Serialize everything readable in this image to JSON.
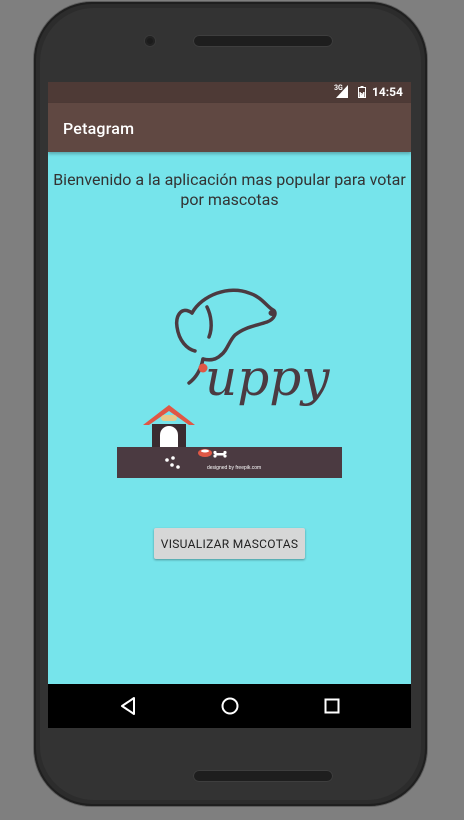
{
  "status_bar": {
    "network": "3G",
    "time": "14:54"
  },
  "app": {
    "title": "Petagram"
  },
  "main": {
    "welcome_text": "Bienvenido a la aplicación mas popular para votar por mascotas",
    "logo": {
      "brand_text": "uppy",
      "credit": "designed by freepik.com"
    },
    "button_label": "VISUALIZAR MASCOTAS"
  },
  "icons": {
    "signal": "signal-icon",
    "battery": "battery-icon",
    "back": "back-icon",
    "home": "home-icon",
    "recents": "recents-icon"
  },
  "colors": {
    "status_bar": "#4e3a36",
    "app_bar": "#604842",
    "background": "#76e4eb",
    "button": "#d6d7d7",
    "logo_brown": "#4b3a41",
    "accent_red": "#e05745"
  }
}
